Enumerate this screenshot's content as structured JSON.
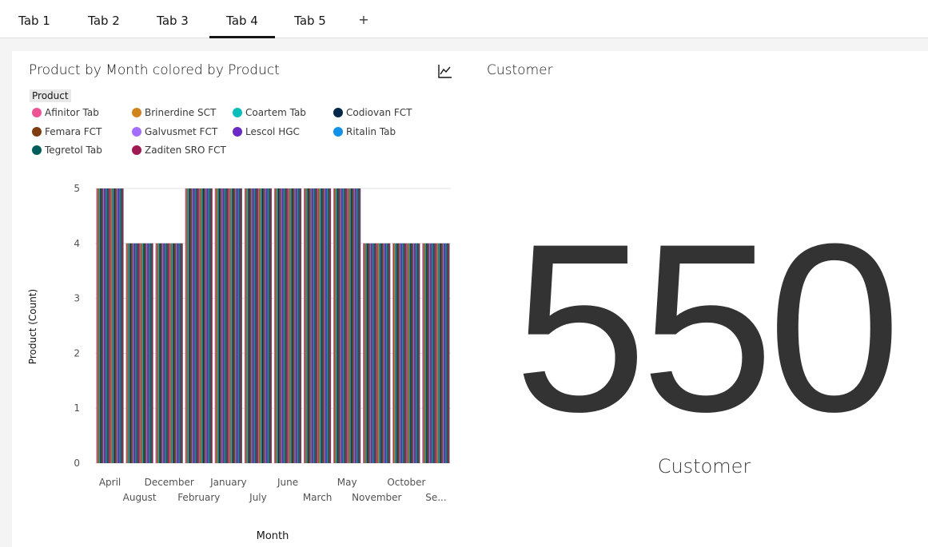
{
  "tabs": [
    {
      "label": "Tab 1"
    },
    {
      "label": "Tab 2"
    },
    {
      "label": "Tab 3"
    },
    {
      "label": "Tab 4"
    },
    {
      "label": "Tab 5"
    }
  ],
  "add_tab_label": "+",
  "active_tab": "Tab 4",
  "bar_widget": {
    "title": "Product by Month colored by Product",
    "chart_type_icon": "line-chart-icon"
  },
  "kpi_widget": {
    "title": "Customer",
    "value": "550",
    "label": "Customer"
  },
  "chart_data": {
    "type": "bar",
    "title": "Product by Month colored by Product",
    "xlabel": "Month",
    "ylabel": "Product (Count)",
    "ylim": [
      0,
      5
    ],
    "y_ticks": [
      0,
      1,
      2,
      3,
      4,
      5
    ],
    "legend_title": "Product",
    "legend_placement": "top-left",
    "categories": [
      "April",
      "August",
      "December",
      "February",
      "January",
      "July",
      "June",
      "March",
      "May",
      "November",
      "October",
      "Se..."
    ],
    "totals": [
      5,
      4,
      4,
      5,
      5,
      5,
      5,
      5,
      5,
      4,
      4,
      4
    ],
    "series": [
      {
        "name": "Afinitor Tab",
        "color": "#ee5396",
        "values": [
          1,
          1,
          1,
          1,
          1,
          1,
          1,
          1,
          1,
          1,
          1,
          1
        ]
      },
      {
        "name": "Brinerdine SCT",
        "color": "#d2841c",
        "values": [
          1,
          1,
          1,
          1,
          1,
          1,
          1,
          1,
          1,
          1,
          1,
          1
        ]
      },
      {
        "name": "Coartem Tab",
        "color": "#08bdba",
        "values": [
          1,
          1,
          1,
          1,
          1,
          1,
          1,
          1,
          1,
          1,
          1,
          1
        ]
      },
      {
        "name": "Codiovan FCT",
        "color": "#012749",
        "values": [
          1,
          1,
          1,
          1,
          1,
          1,
          1,
          1,
          1,
          1,
          1,
          1
        ]
      },
      {
        "name": "Femara FCT",
        "color": "#7f3c10",
        "values": [
          1,
          1,
          1,
          1,
          1,
          1,
          1,
          1,
          1,
          1,
          1,
          1
        ]
      },
      {
        "name": "Galvusmet FCT",
        "color": "#a56eff",
        "values": [
          1,
          1,
          1,
          1,
          1,
          1,
          1,
          1,
          1,
          1,
          1,
          1
        ]
      },
      {
        "name": "Lescol HGC",
        "color": "#6929c4",
        "values": [
          1,
          1,
          1,
          1,
          1,
          1,
          1,
          1,
          1,
          1,
          1,
          1
        ]
      },
      {
        "name": "Ritalin Tab",
        "color": "#1192e8",
        "values": [
          1,
          1,
          1,
          1,
          1,
          1,
          1,
          1,
          1,
          1,
          1,
          1
        ]
      },
      {
        "name": "Tegretol Tab",
        "color": "#005d5d",
        "values": [
          1,
          1,
          1,
          1,
          1,
          1,
          1,
          1,
          1,
          1,
          1,
          1
        ]
      },
      {
        "name": "Zaditen SRO FCT",
        "color": "#9f1853",
        "values": [
          1,
          1,
          1,
          1,
          1,
          1,
          1,
          1,
          1,
          1,
          1,
          1
        ]
      }
    ]
  }
}
